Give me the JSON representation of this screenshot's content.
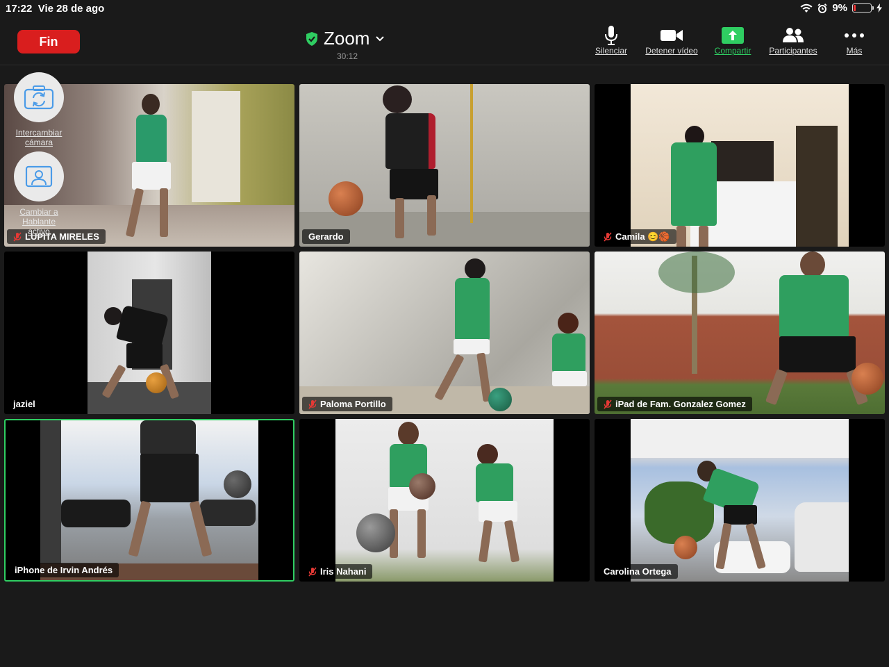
{
  "status": {
    "time": "17:22",
    "date": "Vie 28 de ago",
    "battery": "9%",
    "battery_level": 0.09
  },
  "toolbar": {
    "end_label": "Fin",
    "title": "Zoom",
    "timer": "30:12",
    "mute_label": "Silenciar",
    "video_label": "Detener vídeo",
    "share_label": "Compartir",
    "participants_label": "Participantes",
    "more_label": "Más"
  },
  "camera_controls": {
    "switch_camera_label": "Intercambiar cámara",
    "switch_speaker_label": "Cambiar a Hablante activo"
  },
  "participants": [
    {
      "name": "LUPITA MIRELES",
      "muted": true
    },
    {
      "name": "Gerardo",
      "muted": false
    },
    {
      "name": "Camila 😊🏀",
      "muted": true
    },
    {
      "name": "jaziel",
      "muted": false
    },
    {
      "name": "Paloma Portillo",
      "muted": true
    },
    {
      "name": "iPad de Fam. Gonzalez Gomez",
      "muted": true
    },
    {
      "name": "iPhone de Irvin Andrés",
      "muted": false,
      "active_speaker": true
    },
    {
      "name": "Iris Nahani",
      "muted": true
    },
    {
      "name": "Carolina Ortega",
      "muted": false
    }
  ],
  "colors": {
    "end": "#d91e1e",
    "share": "#2fce62",
    "active_border": "#2fce62",
    "muted_icon": "#e53935"
  }
}
